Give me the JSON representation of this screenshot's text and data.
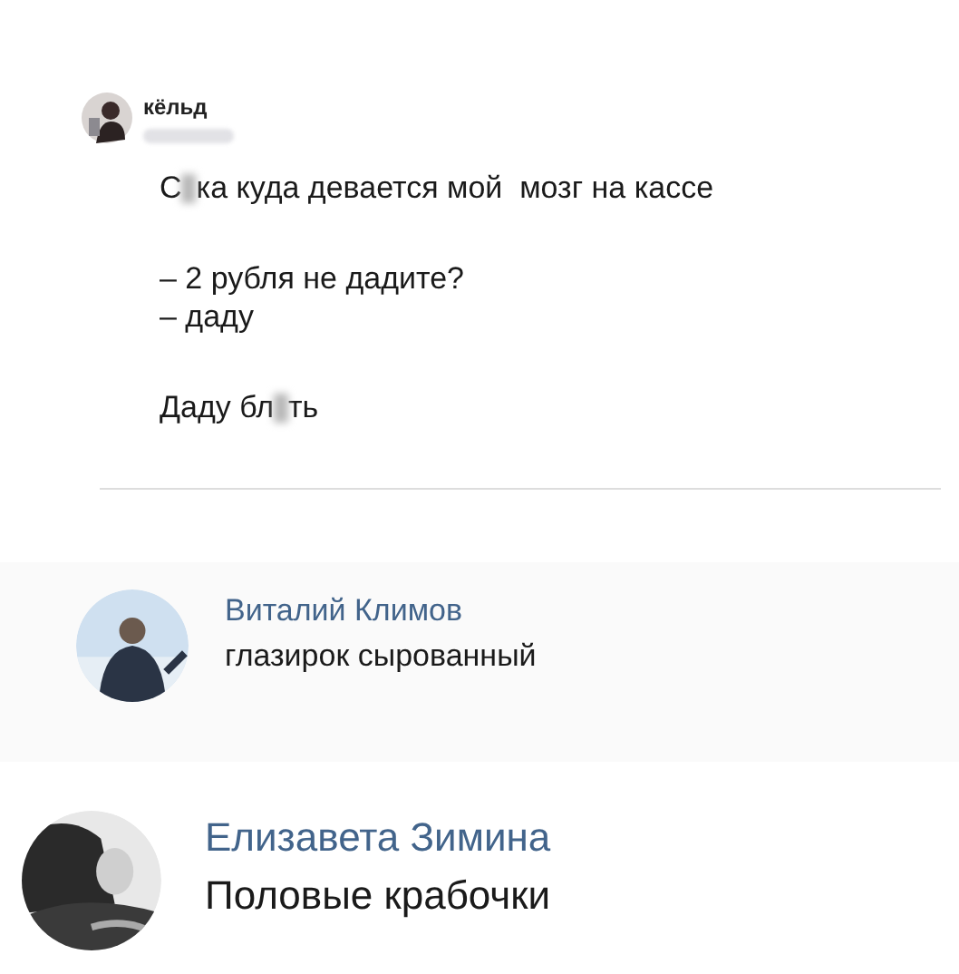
{
  "post": {
    "author": "кёльд",
    "handle_blurred": true,
    "paragraphs": [
      {
        "lines": [
          [
            {
              "kind": "text",
              "text": "С"
            },
            {
              "kind": "blur"
            },
            {
              "kind": "text",
              "text": "ка куда девается мой  мозг на кассе"
            }
          ]
        ]
      },
      {
        "lines": [
          [
            {
              "kind": "text",
              "text": "– 2 рубля не дадите?"
            }
          ],
          [
            {
              "kind": "text",
              "text": "– даду"
            }
          ]
        ]
      },
      {
        "lines": [
          [
            {
              "kind": "text",
              "text": "Даду бл"
            },
            {
              "kind": "blur"
            },
            {
              "kind": "text",
              "text": "ть"
            }
          ]
        ]
      }
    ]
  },
  "comments": [
    {
      "author": "Виталий Климов",
      "text": "глазирок сырованный",
      "kind": "medium"
    },
    {
      "author": "Елизавета Зимина",
      "text": "Половые крабочки",
      "kind": "large"
    }
  ]
}
